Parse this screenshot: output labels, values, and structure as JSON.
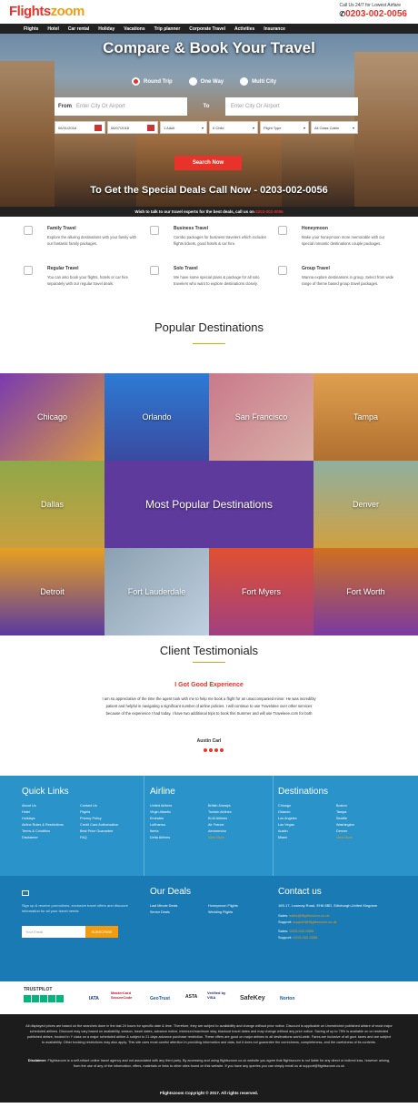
{
  "header": {
    "logo_main": "Flights",
    "logo_accent": "zoom",
    "call_small": "Call Us 24/7 for Lowest Airfare",
    "call_phone": "0203-002-0056"
  },
  "nav": [
    "Flights",
    "Hotel",
    "Car rental",
    "Holiday",
    "Vacations",
    "Trip planner",
    "Corporate Travel",
    "Activities",
    "Insurance"
  ],
  "hero": {
    "title": "Compare & Book Your Travel",
    "radios": [
      "Round Trip",
      "One Way",
      "Multi City"
    ],
    "from_label": "From",
    "from_placeholder": "Enter City Or Airport",
    "to_label": "To",
    "to_placeholder": "Enter City Or Airport",
    "depart_date": "06/31/2018",
    "return_date": "06/07/2018",
    "adults": "1 Adult",
    "child": "0 Child",
    "flight_type": "Flight Type",
    "cabin": "All Class Cabin",
    "search_label": "Search Now",
    "deal_text": "To Get the Special Deals Call Now - 0203-002-0056"
  },
  "strip": {
    "text": "Wish to talk to our travel experts for the best deals, call us on ",
    "phone": "0203-002-0056"
  },
  "travel_types": [
    {
      "title": "Family Travel",
      "text": "Explore the alluring destinations with your family with our fantastic family packages."
    },
    {
      "title": "Business Travel",
      "text": "Combo packages for business travelers which includes flights tickets, good hotels & car hire."
    },
    {
      "title": "Honeymoon",
      "text": "Make your honeymoon more memorable with our special romantic destinations couple packages."
    },
    {
      "title": "Regular Travel",
      "text": "You can also book your flights, hotels or car hire separately with our regular travel deals."
    },
    {
      "title": "Solo Travel",
      "text": "We have some special plans & package for all solo travelers who want to explore destinations closely."
    },
    {
      "title": "Group Travel",
      "text": "Wanna explore destinations in group. Select from wide range of theme based group travel packages."
    }
  ],
  "popular": {
    "title": "Popular Destinations",
    "center": "Most Popular Destinations",
    "cities": [
      "Chicago",
      "Orlando",
      "San Francisco",
      "Tampa",
      "Dallas",
      "Denver",
      "Detroit",
      "Fort Lauderdale",
      "Fort Myers",
      "Fort Worth"
    ]
  },
  "testimonials": {
    "title": "Client Testimonials",
    "heading": "I Got Good Experience",
    "text": "I am so appreciative of the time the agent took with me to help me book a flight for an unaccompanied minor. He was incredibly patient and helpful in navigating a significant number of airline policies. I will continue to use Travelolee over other services because of the experience I had today. I have two additional trips to book this Summer and will use Traveleee.com for both",
    "author": "Austin Carl"
  },
  "footer": {
    "quick_title": "Quick Links",
    "quick": [
      "About Us",
      "Contact Us",
      "Hotel",
      "Flights",
      "Holidays",
      "Privacy Policy",
      "Airline Rules & Restrictions",
      "Credit Card Authorization",
      "Terms & Condition",
      "Best Price Guarantee",
      "Disclaimer",
      "FAQ"
    ],
    "airline_title": "Airline",
    "airline": [
      "United Airlines",
      "British Airways",
      "Virgin Atlantic",
      "Turkish Airlines",
      "Emirates",
      "KLM Airlines",
      "Lufthansa",
      "Air France",
      "Iberia",
      "Aeromexico",
      "Delta Airlines",
      "View More"
    ],
    "dest_title": "Destinations",
    "dest": [
      "Chicago",
      "Boston",
      "Orlando",
      "Tampa",
      "Los Angeles",
      "Seattle",
      "Las Vegas",
      "Washington",
      "Austin",
      "Denver",
      "Miami",
      "View More"
    ],
    "newsletter": "Sign up & receive promotions, exclusive travel offers and discount information for all your travel needs",
    "email_placeholder": "Your Email",
    "subscribe": "SUBSCRIBE",
    "deals_title": "Our Deals",
    "deals": [
      "Last Minute Deals",
      "Honeymoon Flights",
      "Senior Deals",
      "Wedding Flights"
    ],
    "contact_title": "Contact us",
    "address": "169-17, Lowmay Road, EH8 8BD, Edinburgh,United Kingdom",
    "sales_label": "Sales: ",
    "sales": "sales@flightszoom.co.uk",
    "support_label": "Support: ",
    "support": "support@flightszoom.co.uk",
    "sales_phone_label": "Sales: ",
    "sales_phone": "0203-002-0056",
    "support_phone_label": "Support: ",
    "support_phone": "0203-002-0056"
  },
  "logos": [
    "TRUSTPILOT",
    "IATA",
    "MasterCard SecureCode",
    "GeoTrust",
    "ASTA",
    "Verified by VISA",
    "SafeKey",
    "Norton"
  ],
  "disclaimer": {
    "p1": "All displayed prices are based on the searches done in the last 24 hours for specific date & time. Therefore, they are subject to availability and change without prior notice. Discount is applicable on Unrestricted published airfare of most major scheduled airlines. Discount may vary based on availability, season, travel dates, advance notice, minimum/maximum stay, blackout travel dates and may change without any prior notice. Saving of up to 75% is available on on restricted published airfare, booked in Y class on a major scheduled airline & subject to 21 days advance purchase restriction. These offers are good on major airlines to all destinations world-wide. Fares are inclusive of all govt. taxes and are subject to availability. Other booking restrictions may also apply. This site uses most careful attention in providing information and data, but it does not guarantee the correctness, completeness, and the usefulness of its contents.",
    "label": "Disclaimer:",
    "p2": " Flightszoom is a self-reliant online travel agency and not associated with any third party. By accessing and using flightszoom.co.uk website you agree that flightszoom is not liable for any direct or indirect loss, however arising, from the use of any of the information, offers, materials or links to other sites found on this website. If you have any queries you can simply email us at support@flightszoom.co.uk",
    "copyright": "Flightszoom Copyright © 2017. All rights reserved."
  }
}
